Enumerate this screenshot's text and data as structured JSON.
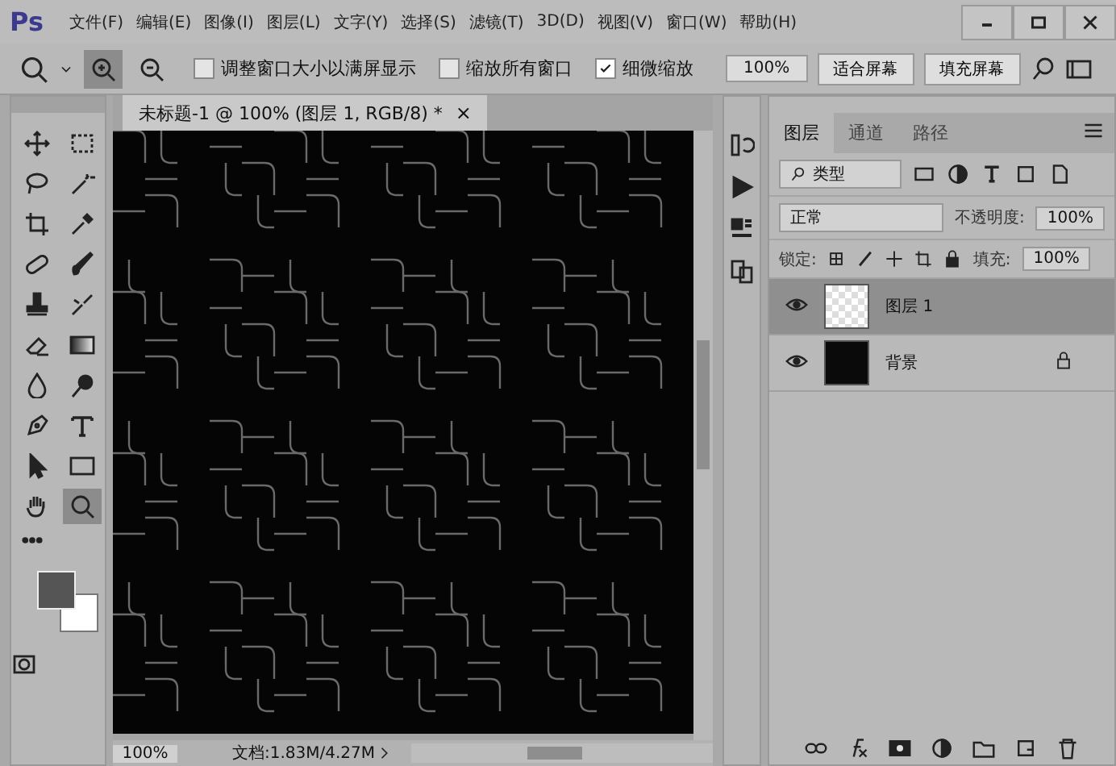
{
  "app": {
    "logo": "Ps",
    "menu": [
      "文件(F)",
      "编辑(E)",
      "图像(I)",
      "图层(L)",
      "文字(Y)",
      "选择(S)",
      "滤镜(T)",
      "3D(D)",
      "视图(V)",
      "窗口(W)",
      "帮助(H)"
    ]
  },
  "options_bar": {
    "zoom_modes": [
      {
        "kind": "in",
        "selected": true
      },
      {
        "kind": "out",
        "selected": false
      }
    ],
    "checkboxes": [
      {
        "label": "调整窗口大小以满屏显示",
        "checked": false
      },
      {
        "label": "缩放所有窗口",
        "checked": false
      },
      {
        "label": "细微缩放",
        "checked": true
      }
    ],
    "zoom_value": "100%",
    "buttons": [
      "适合屏幕",
      "填充屏幕"
    ]
  },
  "toolbox": {
    "tools": [
      {
        "kind": "move",
        "selected": false
      },
      {
        "kind": "marquee",
        "selected": false
      },
      {
        "kind": "lasso",
        "selected": false
      },
      {
        "kind": "wand",
        "selected": false
      },
      {
        "kind": "crop",
        "selected": false
      },
      {
        "kind": "eyedropper",
        "selected": false
      },
      {
        "kind": "heal",
        "selected": false
      },
      {
        "kind": "brush",
        "selected": false
      },
      {
        "kind": "stamp",
        "selected": false
      },
      {
        "kind": "history",
        "selected": false
      },
      {
        "kind": "eraser",
        "selected": false
      },
      {
        "kind": "gradient",
        "selected": false
      },
      {
        "kind": "blur",
        "selected": false
      },
      {
        "kind": "dodge",
        "selected": false
      },
      {
        "kind": "pen",
        "selected": false
      },
      {
        "kind": "type",
        "selected": false
      },
      {
        "kind": "select",
        "selected": false
      },
      {
        "kind": "shape",
        "selected": false
      },
      {
        "kind": "hand",
        "selected": false
      },
      {
        "kind": "zoom",
        "selected": true
      }
    ]
  },
  "document": {
    "tab": "未标题-1 @ 100% (图层 1, RGB/8) *",
    "close": "×",
    "zoom": "100%",
    "info": "文档:1.83M/4.27M"
  },
  "layers_panel": {
    "tabs": [
      {
        "label": "图层",
        "selected": true
      },
      {
        "label": "通道",
        "selected": false
      },
      {
        "label": "路径",
        "selected": false
      }
    ],
    "filter": "类型",
    "blend_mode": "正常",
    "opacity_label": "不透明度:",
    "opacity": "100%",
    "lock_label": "锁定:",
    "fill_label": "填充:",
    "fill": "100%",
    "layers": [
      {
        "name": "图层 1",
        "kind": "transparent",
        "selected": true,
        "locked": false,
        "visible": true
      },
      {
        "name": "背景",
        "kind": "dark",
        "selected": false,
        "locked": true,
        "visible": true
      }
    ]
  }
}
